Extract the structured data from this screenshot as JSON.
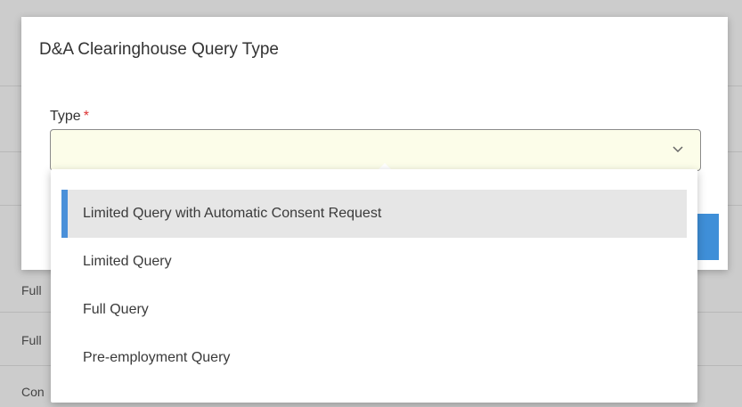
{
  "background": {
    "rows": [
      "Full",
      "Full",
      "Con"
    ]
  },
  "modal": {
    "title": "D&A Clearinghouse Query Type",
    "field_label": "Type",
    "required_mark": "*",
    "select_value": "",
    "chevron_icon": "chevron-down-icon"
  },
  "dropdown": {
    "options": [
      {
        "label": "Limited Query with Automatic Consent Request",
        "selected": true
      },
      {
        "label": "Limited Query",
        "selected": false
      },
      {
        "label": "Full Query",
        "selected": false
      },
      {
        "label": "Pre-employment Query",
        "selected": false
      }
    ]
  },
  "colors": {
    "select_bg": "#fcfde9",
    "selected_accent": "#4a90d9",
    "primary_button": "#3f8fd8"
  }
}
